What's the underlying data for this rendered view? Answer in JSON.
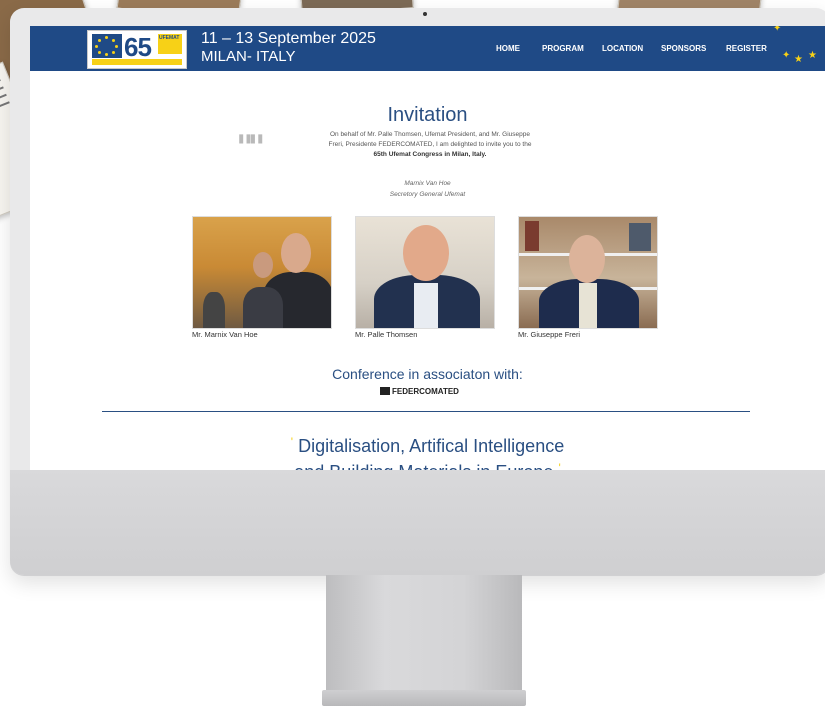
{
  "header": {
    "date": "11 – 13 September 2025",
    "location": "MILAN- ITALY",
    "logo": {
      "number": "65",
      "label": "UFEMAT"
    }
  },
  "nav": {
    "items": [
      {
        "label": "HOME"
      },
      {
        "label": "PROGRAM"
      },
      {
        "label": "LOCATION"
      },
      {
        "label": "SPONSORS"
      },
      {
        "label": "REGISTER"
      }
    ]
  },
  "invitation": {
    "title": "Invitation",
    "quote_mark": "\"",
    "text_line1": "On behalf of Mr. Palle Thomsen, Ufemat President, and Mr. Giuseppe",
    "text_line2": "Freri, Presidente FEDERCOMATED, I am delighted to invite you to the",
    "text_line3": "65th Ufemat Congress in Milan, Italy.",
    "signature_name": "Marnix Van Hoe",
    "signature_role": "Secretory General Ufemat"
  },
  "people": [
    {
      "name": "Mr. Marnix Van Hoe"
    },
    {
      "name": "Mr. Palle Thomsen"
    },
    {
      "name": "Mr. Giuseppe Freri"
    }
  ],
  "association": {
    "heading": "Conference in associaton with:",
    "partner": "FEDERCOMATED"
  },
  "headline": {
    "line1": "Digitalisation, Artifical Intelligence",
    "line2": "and Building Materials in Europe"
  },
  "colors": {
    "brand_blue": "#1f4a86",
    "accent_yellow": "#f7d117"
  }
}
